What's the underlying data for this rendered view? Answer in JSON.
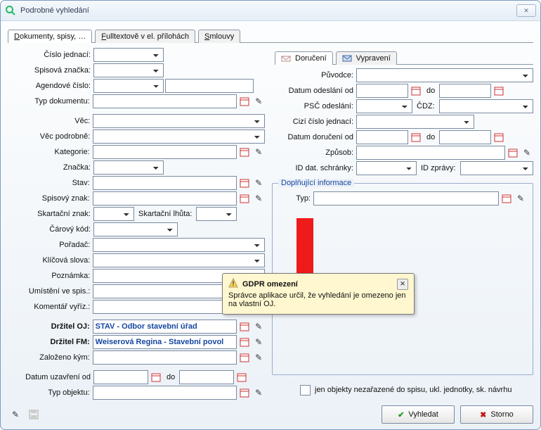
{
  "window": {
    "title": "Podrobné vyhledání"
  },
  "tabs": {
    "main": [
      "Dokumenty, spisy, …",
      "Fulltextově v el. přílohách",
      "Smlouvy"
    ],
    "activeIndex": 0,
    "right": [
      "Doručení",
      "Vypravení"
    ],
    "rightActiveIndex": 0
  },
  "left": {
    "cisloJednaci": {
      "label": "Číslo jednací:"
    },
    "spisovaZnacka": {
      "label": "Spisová značka:"
    },
    "agendoveCislo": {
      "label": "Agendové číslo:"
    },
    "typDokumentu": {
      "label": "Typ dokumentu:"
    },
    "vec": {
      "label": "Věc:"
    },
    "vecPodrobne": {
      "label": "Věc podrobně:"
    },
    "kategorie": {
      "label": "Kategorie:"
    },
    "znacka": {
      "label": "Značka:"
    },
    "stav": {
      "label": "Stav:"
    },
    "spisovyZnak": {
      "label": "Spisový znak:"
    },
    "skartacniZnak": {
      "label": "Skartační znak:"
    },
    "skartacniLhuta": {
      "label": "Skartační lhůta:"
    },
    "carovyKod": {
      "label": "Čárový kód:"
    },
    "poradac": {
      "label": "Pořadač:"
    },
    "klicovaSlova": {
      "label": "Klíčová slova:"
    },
    "poznamka": {
      "label": "Poznámka:"
    },
    "umisteniVeSpis": {
      "label": "Umístění ve spis.:"
    },
    "komentarVyriz": {
      "label": "Komentář vyříz.:"
    },
    "drzitelOJ": {
      "label": "Držitel OJ:",
      "value": "STAV - Odbor stavební úřad"
    },
    "drzitelFM": {
      "label": "Držitel FM:",
      "value": "Weiserová Regina - Stavební povol"
    },
    "zalozenoKym": {
      "label": "Založeno kým:"
    },
    "datumUzavreni": {
      "label": "Datum uzavření od",
      "do": "do"
    },
    "typObjektu": {
      "label": "Typ objektu:"
    }
  },
  "right": {
    "puvodce": {
      "label": "Původce:"
    },
    "datumOdeslaniOd": {
      "label": "Datum odeslání od",
      "do": "do"
    },
    "pscOdeslani": {
      "label": "PSČ odeslání:",
      "cdz": "ČDZ:"
    },
    "ciziCisloJednaci": {
      "label": "Cizí číslo jednací:"
    },
    "datumDoruceniOd": {
      "label": "Datum doručení od",
      "do": "do"
    },
    "zpusob": {
      "label": "Způsob:"
    },
    "idDatSchranky": {
      "label": "ID dat. schránky:",
      "idZpravy": "ID zprávy:"
    }
  },
  "supplement": {
    "legend": "Doplňující informace",
    "typLabel": "Typ:"
  },
  "tooltip": {
    "title": "GDPR omezení",
    "text": "Správce aplikace určil, že vyhledání je omezeno jen na vlastní OJ."
  },
  "bottom": {
    "checkboxLabel": "jen objekty nezařazené do spisu, ukl. jednotky, sk. návrhu",
    "searchLabel": "Vyhledat",
    "cancelLabel": "Storno"
  }
}
